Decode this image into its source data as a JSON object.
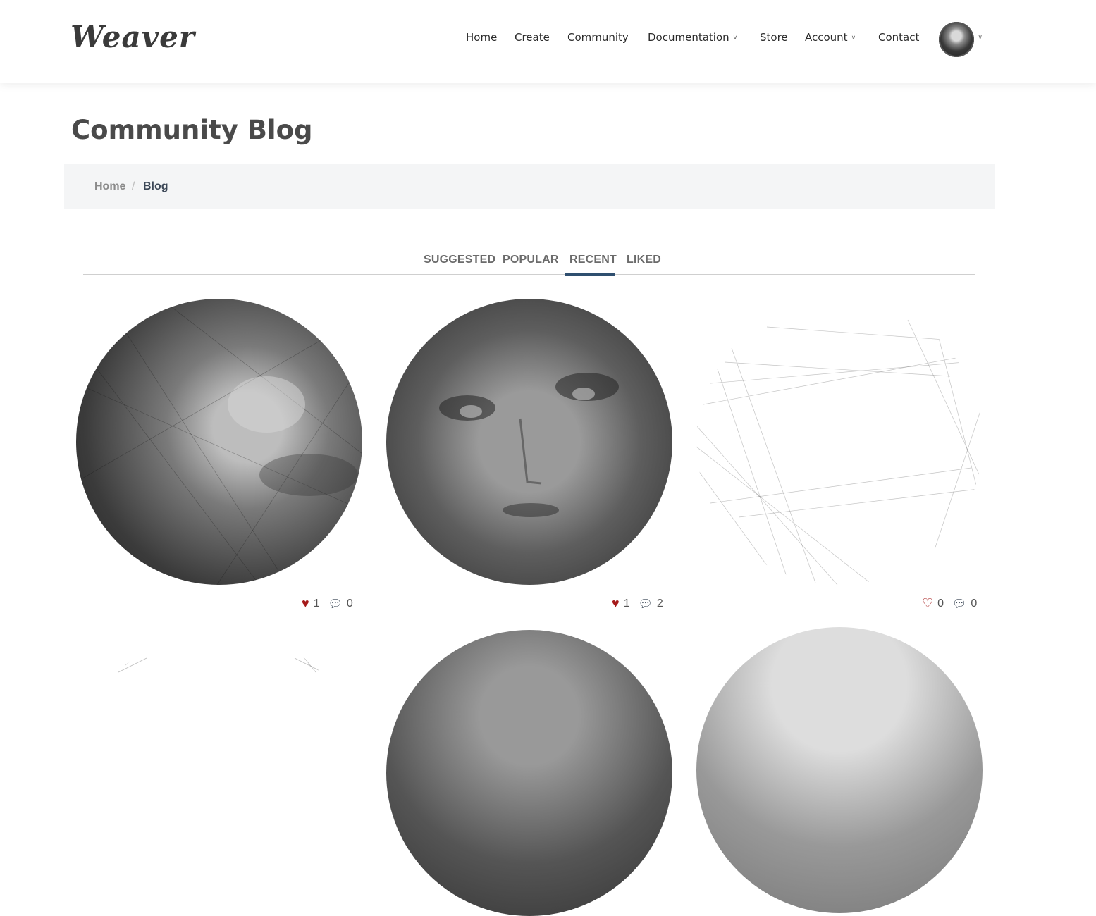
{
  "brand": {
    "logo": "Weaver"
  },
  "nav": {
    "home": "Home",
    "create": "Create",
    "community": "Community",
    "documentation": "Documentation",
    "store": "Store",
    "account": "Account",
    "contact": "Contact"
  },
  "page": {
    "title": "Community Blog"
  },
  "breadcrumb": {
    "home": "Home",
    "separator": "/",
    "current": "Blog"
  },
  "tabs": [
    {
      "label": "SUGGESTED"
    },
    {
      "label": "POPULAR"
    },
    {
      "label": "RECENT",
      "active": true
    },
    {
      "label": "LIKED"
    }
  ],
  "posts": [
    {
      "likes": "1",
      "comments": "0",
      "liked": true,
      "image": "string-art-portrait-woman"
    },
    {
      "likes": "1",
      "comments": "2",
      "liked": true,
      "image": "string-art-portrait-man"
    },
    {
      "likes": "0",
      "comments": "0",
      "liked": false,
      "image": "string-art-sparse-lines"
    }
  ],
  "colors": {
    "like_active": "#a51a1a",
    "tab_active_underline": "#2f4f6f",
    "breadcrumb_bg": "#f4f5f6"
  },
  "icons": {
    "heart_filled": "heart-icon",
    "heart_outline": "heart-outline-icon",
    "comment": "comment-icon",
    "chevron": "chevron-down-icon"
  }
}
